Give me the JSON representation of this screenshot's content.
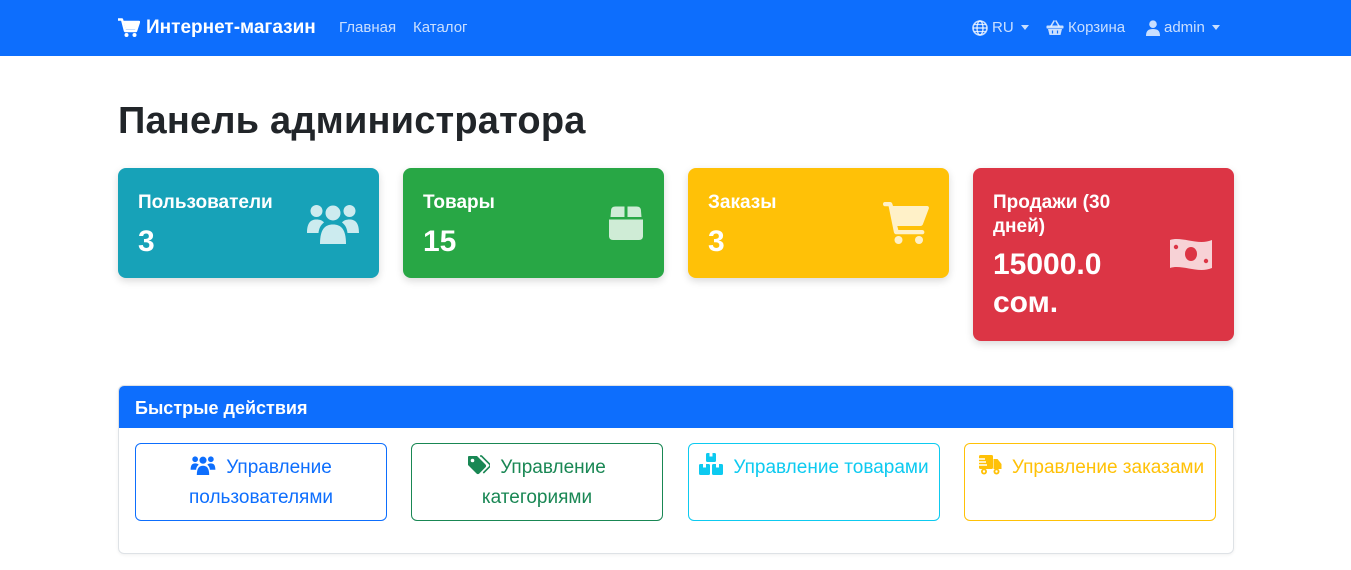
{
  "navbar": {
    "brand": "Интернет-магазин",
    "links": [
      "Главная",
      "Каталог"
    ],
    "language": "RU",
    "cart": "Корзина",
    "user": "admin"
  },
  "page_title": "Панель администратора",
  "stats": [
    {
      "label": "Пользователи",
      "value": "3",
      "icon": "users-icon",
      "color": "#17a2b8"
    },
    {
      "label": "Товары",
      "value": "15",
      "icon": "box-icon",
      "color": "#28a745"
    },
    {
      "label": "Заказы",
      "value": "3",
      "icon": "cart-icon",
      "color": "#ffc107"
    },
    {
      "label": "Продажи (30 дней)",
      "value": "15000.0 сом.",
      "icon": "money-icon",
      "color": "#dc3545"
    }
  ],
  "quick_actions": {
    "title": "Быстрые действия",
    "buttons": [
      {
        "label": "Управление пользователями",
        "icon": "users-icon",
        "color": "#0d6efd"
      },
      {
        "label": "Управление категориями",
        "icon": "tags-icon",
        "color": "#198754"
      },
      {
        "label": "Управление товарами",
        "icon": "boxes-icon",
        "color": "#0dcaf0"
      },
      {
        "label": "Управление заказами",
        "icon": "truck-icon",
        "color": "#ffc107"
      }
    ]
  },
  "colors": {
    "navbar": "#0d6efd",
    "panel_header": "#0d6efd"
  }
}
